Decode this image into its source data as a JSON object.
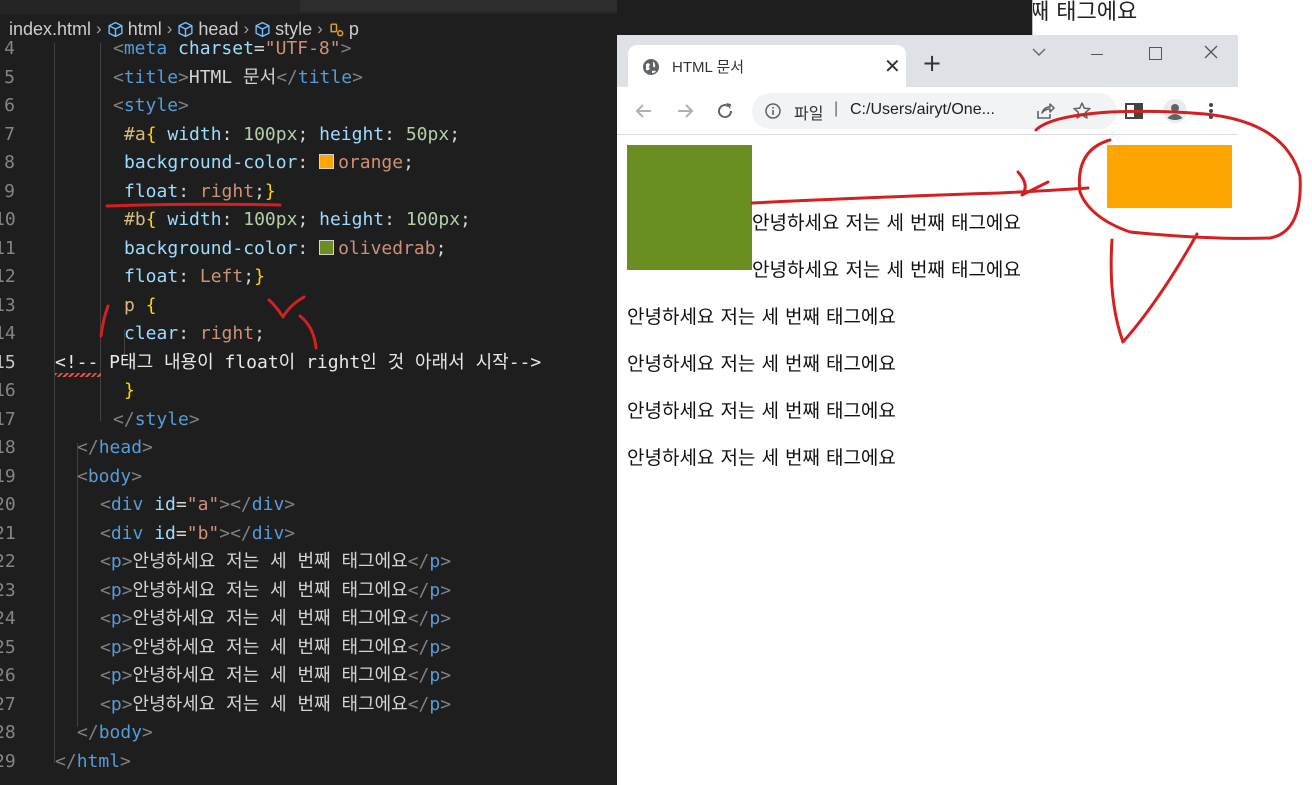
{
  "breadcrumb": {
    "items": [
      "index.html",
      "html",
      "head",
      "style",
      "p"
    ]
  },
  "editor": {
    "lines": [
      {
        "n": "4",
        "tokens": [
          [
            "t-br",
            "<"
          ],
          [
            "t-tag",
            "meta"
          ],
          [
            "t-pun",
            " "
          ],
          [
            "t-attr",
            "charset"
          ],
          [
            "t-pun",
            "="
          ],
          [
            "t-str",
            "\"UTF-8\""
          ],
          [
            "t-br",
            ">"
          ]
        ]
      },
      {
        "n": "5",
        "tokens": [
          [
            "t-br",
            "<"
          ],
          [
            "t-tag",
            "title"
          ],
          [
            "t-br",
            ">"
          ],
          [
            "t-text",
            "HTML 문서"
          ],
          [
            "t-br",
            "</"
          ],
          [
            "t-tag",
            "title"
          ],
          [
            "t-br",
            ">"
          ]
        ]
      },
      {
        "n": "6",
        "tokens": [
          [
            "t-br",
            "<"
          ],
          [
            "t-tag",
            "style"
          ],
          [
            "t-br",
            ">"
          ]
        ]
      },
      {
        "n": "7",
        "tokens": [
          [
            "t-sel",
            "#a"
          ],
          [
            "t-brace",
            "{"
          ],
          [
            "t-pun",
            " "
          ],
          [
            "t-prop",
            "width"
          ],
          [
            "t-pun",
            ": "
          ],
          [
            "t-num",
            "100px"
          ],
          [
            "t-pun",
            "; "
          ],
          [
            "t-prop",
            "height"
          ],
          [
            "t-pun",
            ": "
          ],
          [
            "t-num",
            "50px"
          ],
          [
            "t-pun",
            ";"
          ]
        ]
      },
      {
        "n": "8",
        "tokens": [
          [
            "t-prop",
            "background-color"
          ],
          [
            "t-pun",
            ": "
          ],
          [
            "swatch",
            "#ffa500"
          ],
          [
            "t-val",
            "orange"
          ],
          [
            "t-pun",
            ";"
          ]
        ]
      },
      {
        "n": "9",
        "tokens": [
          [
            "t-prop",
            "float"
          ],
          [
            "t-pun",
            ": "
          ],
          [
            "t-val",
            "right"
          ],
          [
            "t-pun",
            ";"
          ],
          [
            "t-brace",
            "}"
          ]
        ]
      },
      {
        "n": "10",
        "tokens": [
          [
            "t-sel",
            "#b"
          ],
          [
            "t-brace",
            "{"
          ],
          [
            "t-pun",
            " "
          ],
          [
            "t-prop",
            "width"
          ],
          [
            "t-pun",
            ": "
          ],
          [
            "t-num",
            "100px"
          ],
          [
            "t-pun",
            "; "
          ],
          [
            "t-prop",
            "height"
          ],
          [
            "t-pun",
            ": "
          ],
          [
            "t-num",
            "100px"
          ],
          [
            "t-pun",
            ";"
          ]
        ]
      },
      {
        "n": "11",
        "tokens": [
          [
            "t-prop",
            "background-color"
          ],
          [
            "t-pun",
            ": "
          ],
          [
            "swatch",
            "#6b8e23"
          ],
          [
            "t-val",
            "olivedrab"
          ],
          [
            "t-pun",
            ";"
          ]
        ]
      },
      {
        "n": "12",
        "tokens": [
          [
            "t-prop",
            "float"
          ],
          [
            "t-pun",
            ": "
          ],
          [
            "t-val",
            "Left"
          ],
          [
            "t-pun",
            ";"
          ],
          [
            "t-brace",
            "}"
          ]
        ]
      },
      {
        "n": "13",
        "tokens": [
          [
            "t-p",
            "p"
          ],
          [
            "t-pun",
            " "
          ],
          [
            "t-brace",
            "{"
          ]
        ]
      },
      {
        "n": "14",
        "tokens": [
          [
            "t-prop",
            "clear"
          ],
          [
            "t-pun",
            ": "
          ],
          [
            "t-val",
            "right"
          ],
          [
            "t-pun",
            ";"
          ]
        ]
      },
      {
        "n": "15",
        "tokens": [
          [
            "t-com",
            "<!-- P태그 내용이 float이 right인 것 아래서 시작-->"
          ]
        ]
      },
      {
        "n": "16",
        "tokens": [
          [
            "t-brace",
            "}"
          ]
        ]
      },
      {
        "n": "17",
        "tokens": [
          [
            "t-br",
            "</"
          ],
          [
            "t-tag",
            "style"
          ],
          [
            "t-br",
            ">"
          ]
        ]
      },
      {
        "n": "18",
        "tokens": [
          [
            "t-br",
            "</"
          ],
          [
            "t-tag",
            "head"
          ],
          [
            "t-br",
            ">"
          ]
        ]
      },
      {
        "n": "19",
        "tokens": [
          [
            "t-br",
            "<"
          ],
          [
            "t-tag",
            "body"
          ],
          [
            "t-br",
            ">"
          ]
        ]
      },
      {
        "n": "20",
        "tokens": [
          [
            "t-br",
            "<"
          ],
          [
            "t-tag",
            "div"
          ],
          [
            "t-pun",
            " "
          ],
          [
            "t-attr",
            "id"
          ],
          [
            "t-pun",
            "="
          ],
          [
            "t-str",
            "\"a\""
          ],
          [
            "t-br",
            "></"
          ],
          [
            "t-tag",
            "div"
          ],
          [
            "t-br",
            ">"
          ]
        ]
      },
      {
        "n": "21",
        "tokens": [
          [
            "t-br",
            "<"
          ],
          [
            "t-tag",
            "div"
          ],
          [
            "t-pun",
            " "
          ],
          [
            "t-attr",
            "id"
          ],
          [
            "t-pun",
            "="
          ],
          [
            "t-str",
            "\"b\""
          ],
          [
            "t-br",
            "></"
          ],
          [
            "t-tag",
            "div"
          ],
          [
            "t-br",
            ">"
          ]
        ]
      },
      {
        "n": "22",
        "tokens": [
          [
            "t-br",
            "<"
          ],
          [
            "t-tag",
            "p"
          ],
          [
            "t-br",
            ">"
          ],
          [
            "t-text",
            "안녕하세요 저는 세 번째 태그에요"
          ],
          [
            "t-br",
            "</"
          ],
          [
            "t-tag",
            "p"
          ],
          [
            "t-br",
            ">"
          ]
        ]
      },
      {
        "n": "23",
        "tokens": [
          [
            "t-br",
            "<"
          ],
          [
            "t-tag",
            "p"
          ],
          [
            "t-br",
            ">"
          ],
          [
            "t-text",
            "안녕하세요 저는 세 번째 태그에요"
          ],
          [
            "t-br",
            "</"
          ],
          [
            "t-tag",
            "p"
          ],
          [
            "t-br",
            ">"
          ]
        ]
      },
      {
        "n": "24",
        "tokens": [
          [
            "t-br",
            "<"
          ],
          [
            "t-tag",
            "p"
          ],
          [
            "t-br",
            ">"
          ],
          [
            "t-text",
            "안녕하세요 저는 세 번째 태그에요"
          ],
          [
            "t-br",
            "</"
          ],
          [
            "t-tag",
            "p"
          ],
          [
            "t-br",
            ">"
          ]
        ]
      },
      {
        "n": "25",
        "tokens": [
          [
            "t-br",
            "<"
          ],
          [
            "t-tag",
            "p"
          ],
          [
            "t-br",
            ">"
          ],
          [
            "t-text",
            "안녕하세요 저는 세 번째 태그에요"
          ],
          [
            "t-br",
            "</"
          ],
          [
            "t-tag",
            "p"
          ],
          [
            "t-br",
            ">"
          ]
        ]
      },
      {
        "n": "26",
        "tokens": [
          [
            "t-br",
            "<"
          ],
          [
            "t-tag",
            "p"
          ],
          [
            "t-br",
            ">"
          ],
          [
            "t-text",
            "안녕하세요 저는 세 번째 태그에요"
          ],
          [
            "t-br",
            "</"
          ],
          [
            "t-tag",
            "p"
          ],
          [
            "t-br",
            ">"
          ]
        ]
      },
      {
        "n": "27",
        "tokens": [
          [
            "t-br",
            "<"
          ],
          [
            "t-tag",
            "p"
          ],
          [
            "t-br",
            ">"
          ],
          [
            "t-text",
            "안녕하세요 저는 세 번째 태그에요"
          ],
          [
            "t-br",
            "</"
          ],
          [
            "t-tag",
            "p"
          ],
          [
            "t-br",
            ">"
          ]
        ]
      },
      {
        "n": "28",
        "tokens": [
          [
            "t-br",
            "</"
          ],
          [
            "t-tag",
            "body"
          ],
          [
            "t-br",
            ">"
          ]
        ]
      },
      {
        "n": "29",
        "tokens": [
          [
            "t-br",
            "</"
          ],
          [
            "t-tag",
            "html"
          ],
          [
            "t-br",
            ">"
          ]
        ]
      }
    ]
  },
  "browser": {
    "tab_title": "HTML 문서",
    "new_tab": "+",
    "address_scheme": "파일",
    "address_sep": "|",
    "address_url": "C:/Users/airyt/One...",
    "paragraphs": [
      "안녕하세요 저는 세 번째 태그에요",
      "안녕하세요 저는 세 번째 태그에요",
      "안녕하세요 저는 세 번째 태그에요",
      "안녕하세요 저는 세 번째 태그에요",
      "안녕하세요 저는 세 번째 태그에요",
      "안녕하세요 저는 세 번째 태그에요"
    ],
    "box_a_color": "#ffa500",
    "box_b_color": "#6b8e23"
  },
  "background_window": {
    "text": "째 태그에요"
  },
  "colors": {
    "annotation_red": "#d42020"
  }
}
